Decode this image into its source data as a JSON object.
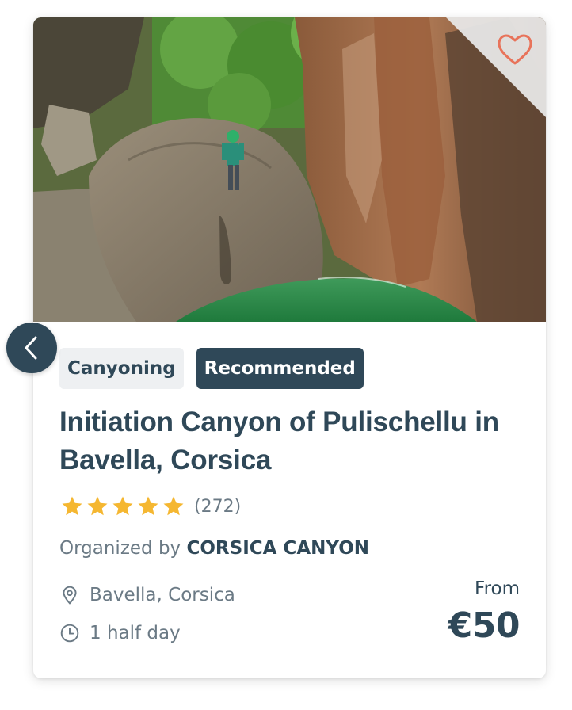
{
  "card": {
    "tags": {
      "category": "Canyoning",
      "recommended": "Recommended"
    },
    "title": "Initiation Canyon of Pulischellu in Bavella, Corsica",
    "rating": {
      "stars": 5,
      "max_stars": 5,
      "review_count": "(272)"
    },
    "organizer": {
      "prefix": "Organized by",
      "name": "CORSICA CANYON"
    },
    "location": "Bavella, Corsica",
    "duration": "1 half day",
    "price": {
      "from_label": "From",
      "value": "€50"
    },
    "icons": {
      "favorite": "heart-outline-icon",
      "back": "chevron-left-icon",
      "location": "map-pin-icon",
      "duration": "clock-icon",
      "star": "star-icon"
    }
  },
  "colors": {
    "primary": "#2f4858",
    "muted_text": "#6b7a85",
    "star": "#f5b731",
    "heart": "#e8735a",
    "tag_bg": "#eef0f2"
  }
}
